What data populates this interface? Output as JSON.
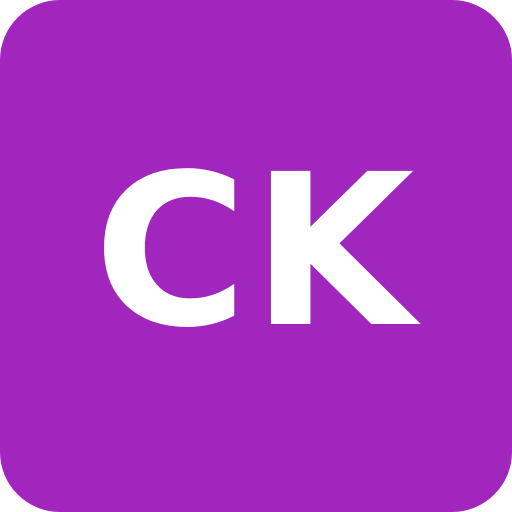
{
  "avatar": {
    "initials": "CK",
    "background_color": "#A126BE",
    "text_color": "#FFFFFF"
  }
}
